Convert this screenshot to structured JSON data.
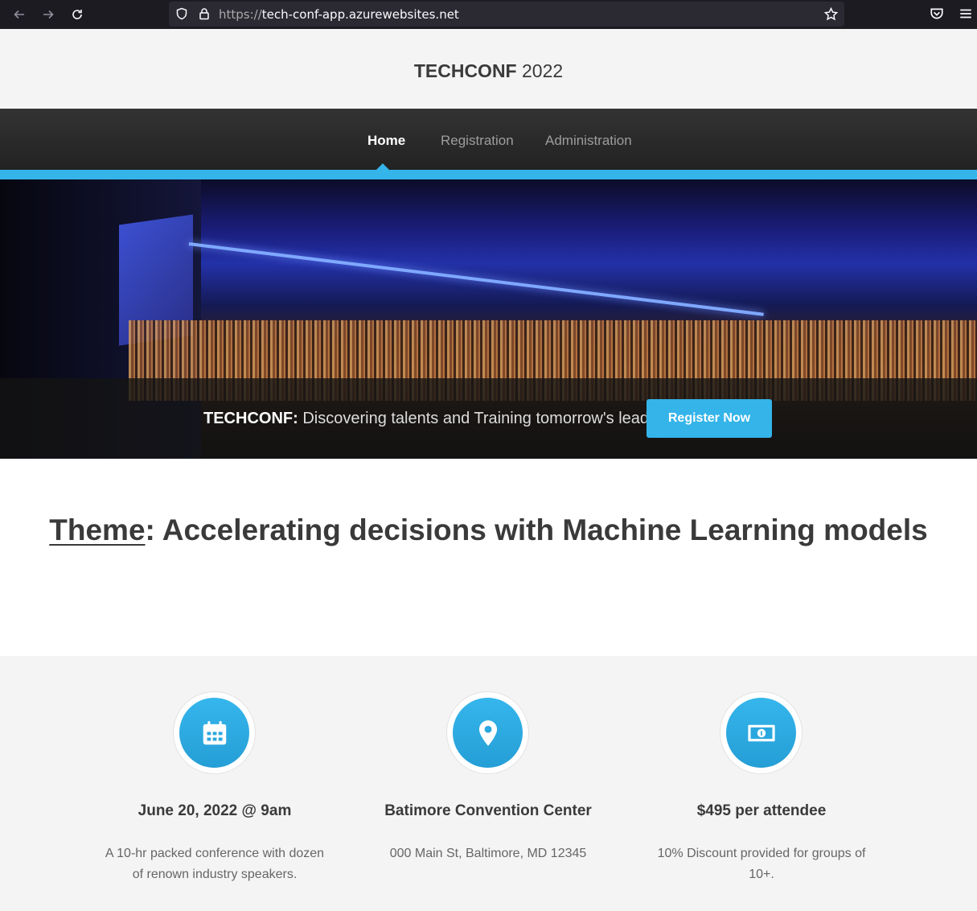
{
  "browser": {
    "url_protocol": "https://",
    "url_host": "tech-conf-app.azurewebsites.net",
    "icons": [
      "back-icon",
      "forward-icon",
      "reload-icon",
      "shield-icon",
      "lock-icon",
      "star-icon",
      "pocket-icon",
      "menu-icon"
    ]
  },
  "header": {
    "logo_bold": "TECHCONF",
    "logo_year": "2022"
  },
  "nav": {
    "items": [
      {
        "label": "Home",
        "active": true
      },
      {
        "label": "Registration",
        "active": false
      },
      {
        "label": "Administration",
        "active": false
      }
    ]
  },
  "hero": {
    "tagline_bold": "TECHCONF:",
    "tagline_text": "Discovering talents and Training tomorrow's leaders",
    "cta_label": "Register Now"
  },
  "theme": {
    "label": "Theme",
    "text": ": Accelerating decisions with Machine Learning models"
  },
  "info": {
    "columns": [
      {
        "icon": "calendar-icon",
        "title": "June 20, 2022 @ 9am",
        "desc": "A 10-hr packed conference with dozen of renown industry speakers."
      },
      {
        "icon": "map-pin-icon",
        "title": "Batimore Convention Center",
        "desc": "000 Main St, Baltimore, MD 12345"
      },
      {
        "icon": "money-icon",
        "title": "$495 per attendee",
        "desc": "10% Discount provided for groups of 10+."
      }
    ]
  },
  "colors": {
    "accent": "#34b4e9",
    "navbar": "#2a2a2a",
    "text": "#3a3a3a"
  }
}
